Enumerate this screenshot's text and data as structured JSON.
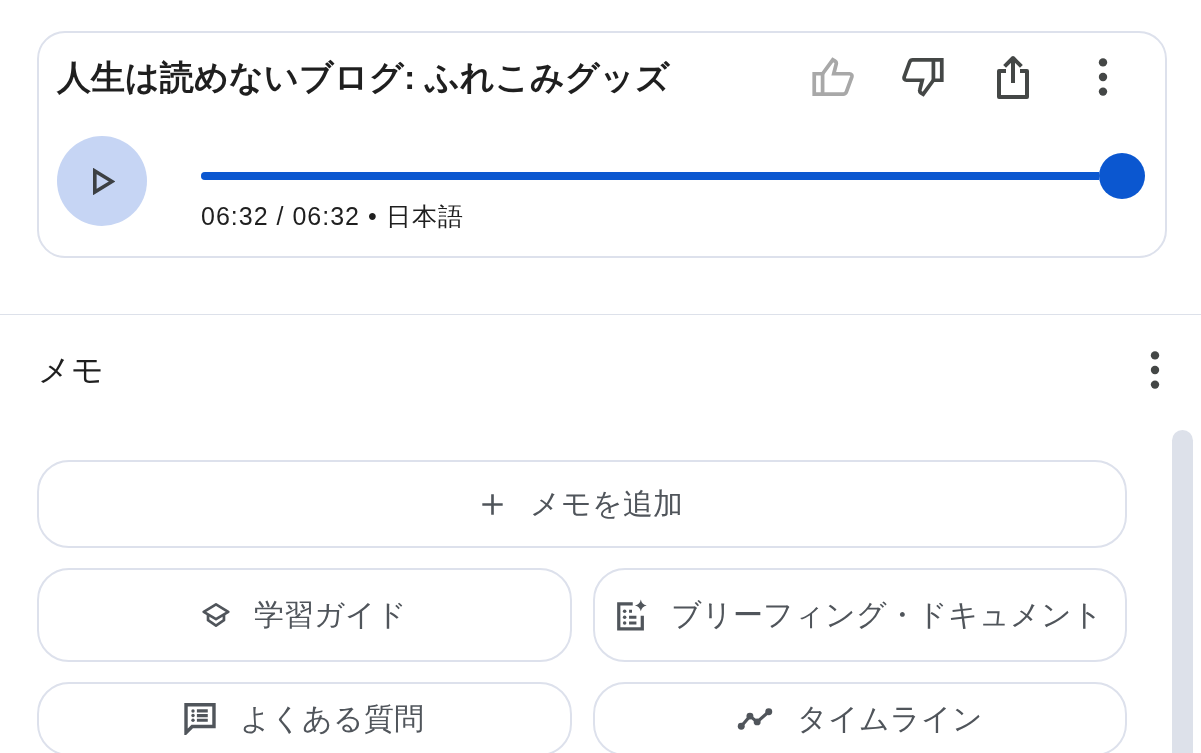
{
  "audio_overview": {
    "title": "人生は読めないブログ: ふれこみグッズ",
    "actions": [
      {
        "kind": "thumbs_up",
        "disabled": true
      },
      {
        "kind": "thumbs_down",
        "disabled": false
      },
      {
        "kind": "share",
        "disabled": false
      },
      {
        "kind": "more",
        "disabled": false
      }
    ],
    "player": {
      "level": 1,
      "time": "06:32 / 06:32 • 日本語"
    }
  },
  "notes": {
    "title": "メモ",
    "add_note": "メモを追加",
    "tools": [
      {
        "kind": "study_guide",
        "label": "学習ガイド"
      },
      {
        "kind": "briefing_doc",
        "label": "ブリーフィング・ドキュメント"
      },
      {
        "kind": "faq",
        "label": "よくある質問"
      },
      {
        "kind": "timeline",
        "label": "タイムライン"
      }
    ]
  }
}
